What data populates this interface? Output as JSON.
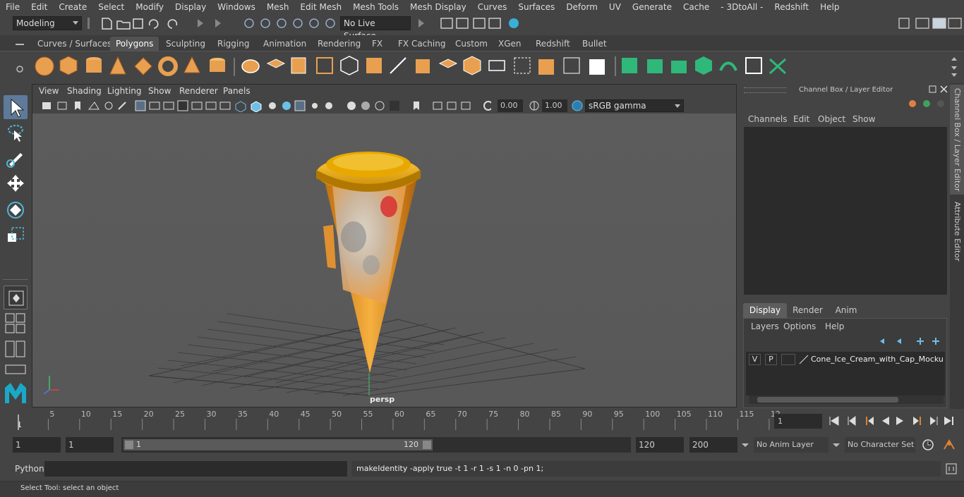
{
  "menubar": [
    "File",
    "Edit",
    "Create",
    "Select",
    "Modify",
    "Display",
    "Windows",
    "Mesh",
    "Edit Mesh",
    "Mesh Tools",
    "Mesh Display",
    "Curves",
    "Surfaces",
    "Deform",
    "UV",
    "Generate",
    "Cache",
    "- 3DtoAll -",
    "Redshift",
    "Help"
  ],
  "status": {
    "mode": "Modeling",
    "live_surface": "No Live Surface"
  },
  "shelf_tabs": [
    "Curves / Surfaces",
    "Polygons",
    "Sculpting",
    "Rigging",
    "Animation",
    "Rendering",
    "FX",
    "FX Caching",
    "Custom",
    "XGen",
    "Redshift",
    "Bullet"
  ],
  "shelf_active": "Polygons",
  "viewport": {
    "menu": [
      "View",
      "Shading",
      "Lighting",
      "Show",
      "Renderer",
      "Panels"
    ],
    "exposure": "0.00",
    "gamma": "1.00",
    "color_space": "sRGB gamma",
    "camera_label": "persp"
  },
  "channel_box": {
    "title": "Channel Box / Layer Editor",
    "menu": [
      "Channels",
      "Edit",
      "Object",
      "Show"
    ],
    "layer_tabs": [
      "Display",
      "Render",
      "Anim"
    ],
    "layer_tab_active": "Display",
    "layer_menu": [
      "Layers",
      "Options",
      "Help"
    ],
    "layer": {
      "v": "V",
      "p": "P",
      "name": "Cone_Ice_Cream_with_Cap_Mockup_"
    }
  },
  "side_tabs": [
    "Channel Box / Layer Editor",
    "Attribute Editor"
  ],
  "timeline": {
    "ticks": [
      "5",
      "10",
      "15",
      "20",
      "25",
      "30",
      "35",
      "40",
      "45",
      "50",
      "55",
      "60",
      "65",
      "70",
      "75",
      "80",
      "85",
      "90",
      "95",
      "100",
      "105",
      "110",
      "115",
      "12"
    ],
    "start_label": "1",
    "current_frame": "1"
  },
  "range": {
    "start": "1",
    "playback_start": "1",
    "slider_start": "1",
    "slider_end": "120",
    "playback_end": "120",
    "end": "200",
    "anim_layer": "No Anim Layer",
    "char_set": "No Character Set"
  },
  "cmdline": {
    "lang": "Python",
    "result": "makeIdentity -apply true -t 1 -r 1 -s 1 -n 0 -pn 1;"
  },
  "help": "Select Tool: select an object"
}
